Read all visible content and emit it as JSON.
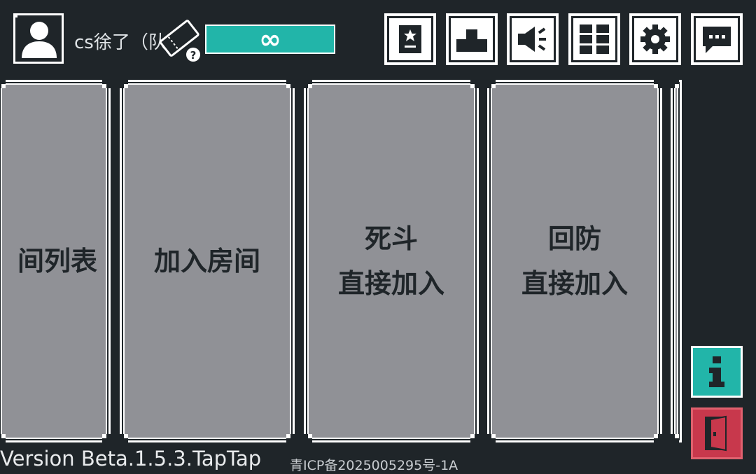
{
  "player": {
    "username": "cs徐了（队",
    "energy": "∞"
  },
  "top_buttons": [
    {
      "name": "achievement-book-button",
      "icon": "badge-book-icon"
    },
    {
      "name": "leaderboard-button",
      "icon": "podium-icon"
    },
    {
      "name": "sound-button",
      "icon": "speaker-icon"
    },
    {
      "name": "grid-menu-button",
      "icon": "grid-icon"
    },
    {
      "name": "settings-button",
      "icon": "gear-icon"
    },
    {
      "name": "chat-button",
      "icon": "chat-bubble-icon"
    }
  ],
  "panels": {
    "room_list": {
      "line1": "间列表"
    },
    "join_room": {
      "line1": "加入房间"
    },
    "deathmatch": {
      "line1": "死斗",
      "line2": "直接加入"
    },
    "defense": {
      "line1": "回防",
      "line2": "直接加入"
    }
  },
  "footer": {
    "version": "Version Beta.1.5.3.TapTap",
    "icp": "青ICP备2025005295号-1A"
  },
  "colors": {
    "background": "#1f2529",
    "panel": "#909196",
    "accent_teal": "#22b5a9",
    "exit_red": "#c8384c"
  }
}
